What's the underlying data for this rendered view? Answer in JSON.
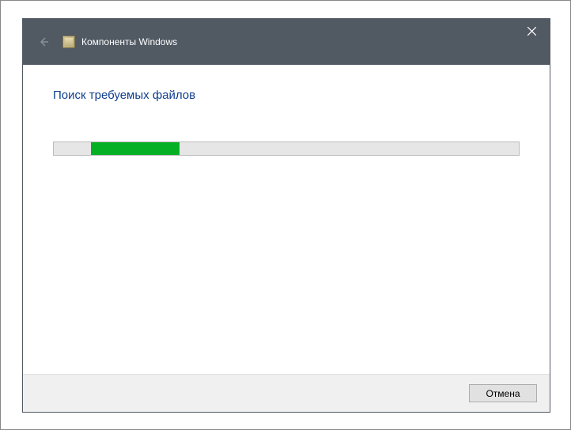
{
  "window": {
    "title": "Компоненты Windows"
  },
  "content": {
    "heading": "Поиск требуемых файлов"
  },
  "progress": {
    "offset_percent": 8,
    "width_percent": 19
  },
  "footer": {
    "cancel_label": "Отмена"
  }
}
